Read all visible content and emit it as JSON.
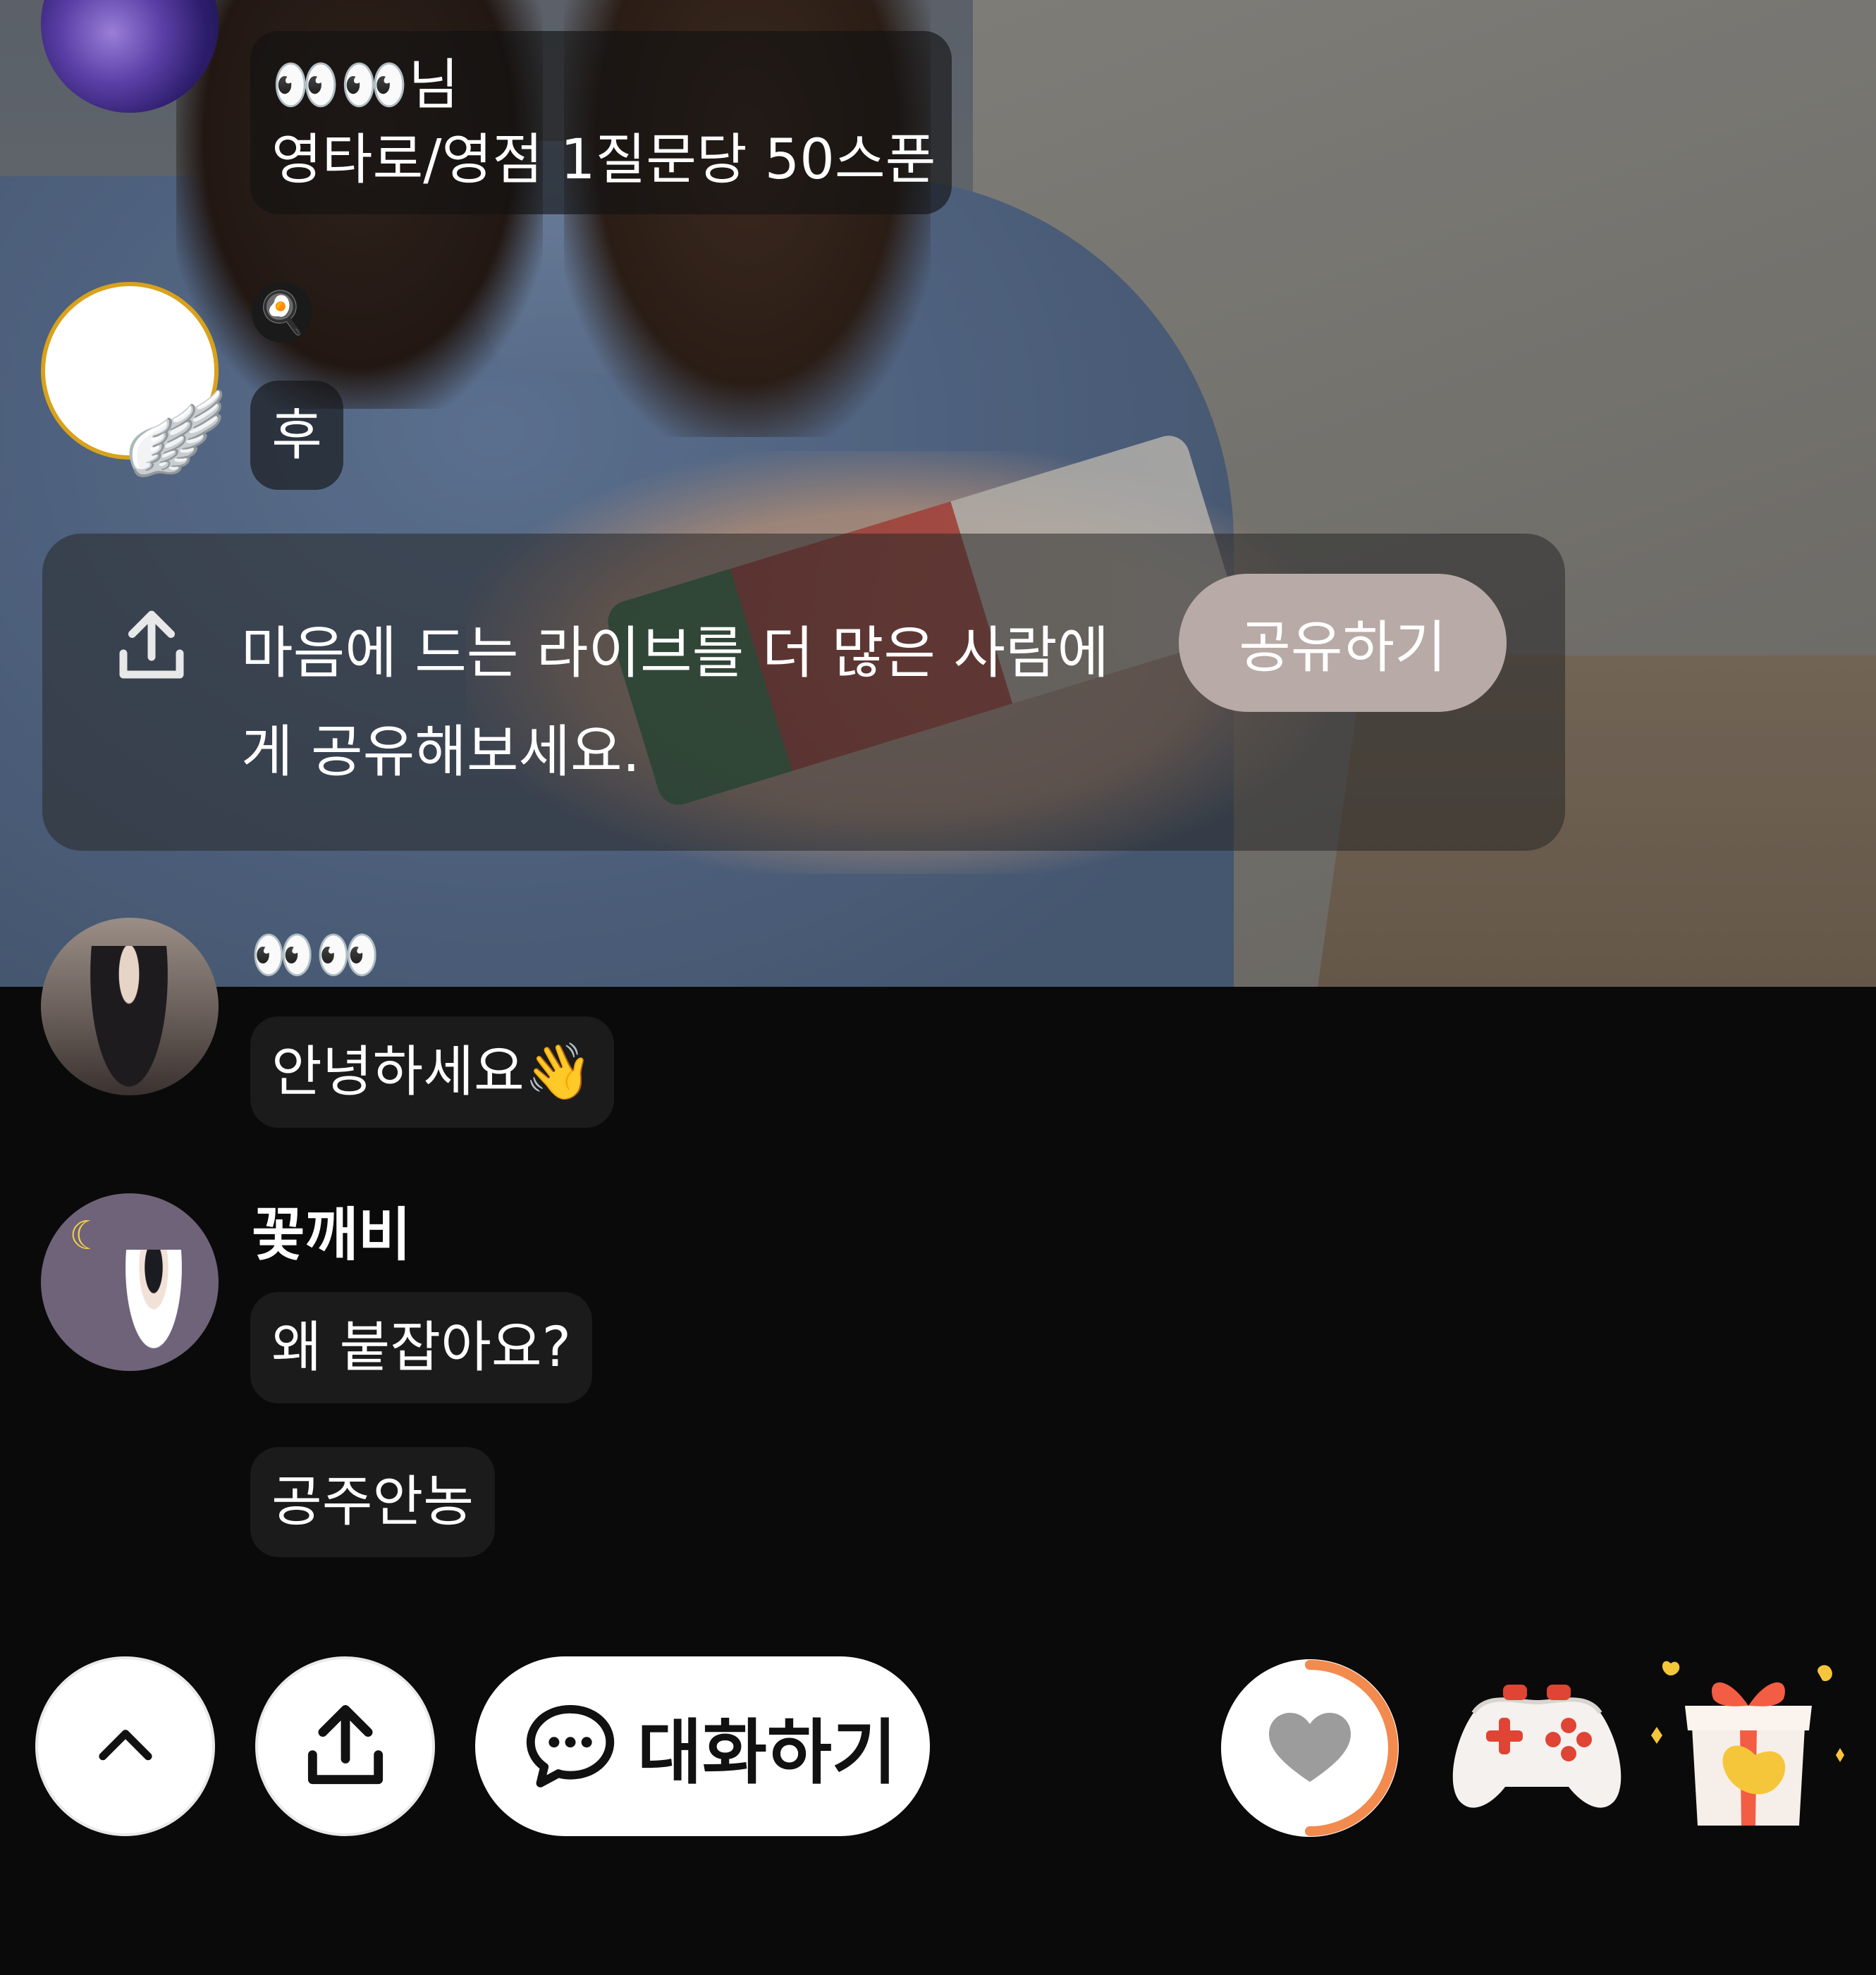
{
  "chat": {
    "messages": [
      {
        "sender": "👀👀님",
        "text": "영타로/영점 1질문당 50스푼"
      },
      {
        "sender": "🍳",
        "text": "후"
      },
      {
        "sender": "👀👀",
        "text": "안녕하세요👋"
      },
      {
        "sender": "꽃깨비",
        "texts": [
          "왜 붙잡아요?",
          "공주안농"
        ]
      }
    ]
  },
  "share_card": {
    "text": "마음에 드는 라이브를 더 많은 사람에게 공유해보세요.",
    "button_label": "공유하기"
  },
  "bottom_bar": {
    "chat_label": "대화하기"
  },
  "icons": {
    "up": "chevron-up-icon",
    "share": "share-upload-icon",
    "chat": "speech-bubble-icon",
    "heart": "heart-icon",
    "game": "game-controller-icon",
    "gift": "gift-box-icon"
  },
  "colors": {
    "background": "#0a0a0a",
    "bubble": "#1b1b1b",
    "heart_ring": "#f38a4e",
    "share_button": "#b8aaa6",
    "avatar_ring": "#d9a21b"
  },
  "heart_progress": 0.5
}
